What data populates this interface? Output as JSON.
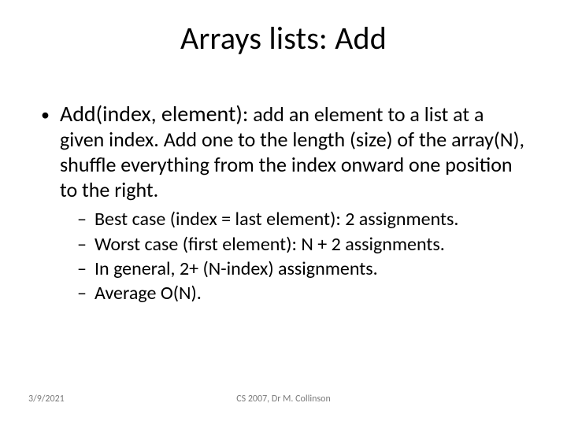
{
  "title": "Arrays lists: Add",
  "main": {
    "lead": "Add(index, element):",
    "rest": " add an element to a list at a given index. Add one to the length (size) of the array(N), shuffle everything from the index onward one position to the right."
  },
  "sub": [
    " Best case (index = last element): 2 assignments.",
    " Worst case (first element): N + 2 assignments.",
    "In general, 2+ (N-index) assignments.",
    "Average O(N)."
  ],
  "footer": {
    "date": "3/9/2021",
    "center": "CS 2007,  Dr M. Collinson"
  }
}
